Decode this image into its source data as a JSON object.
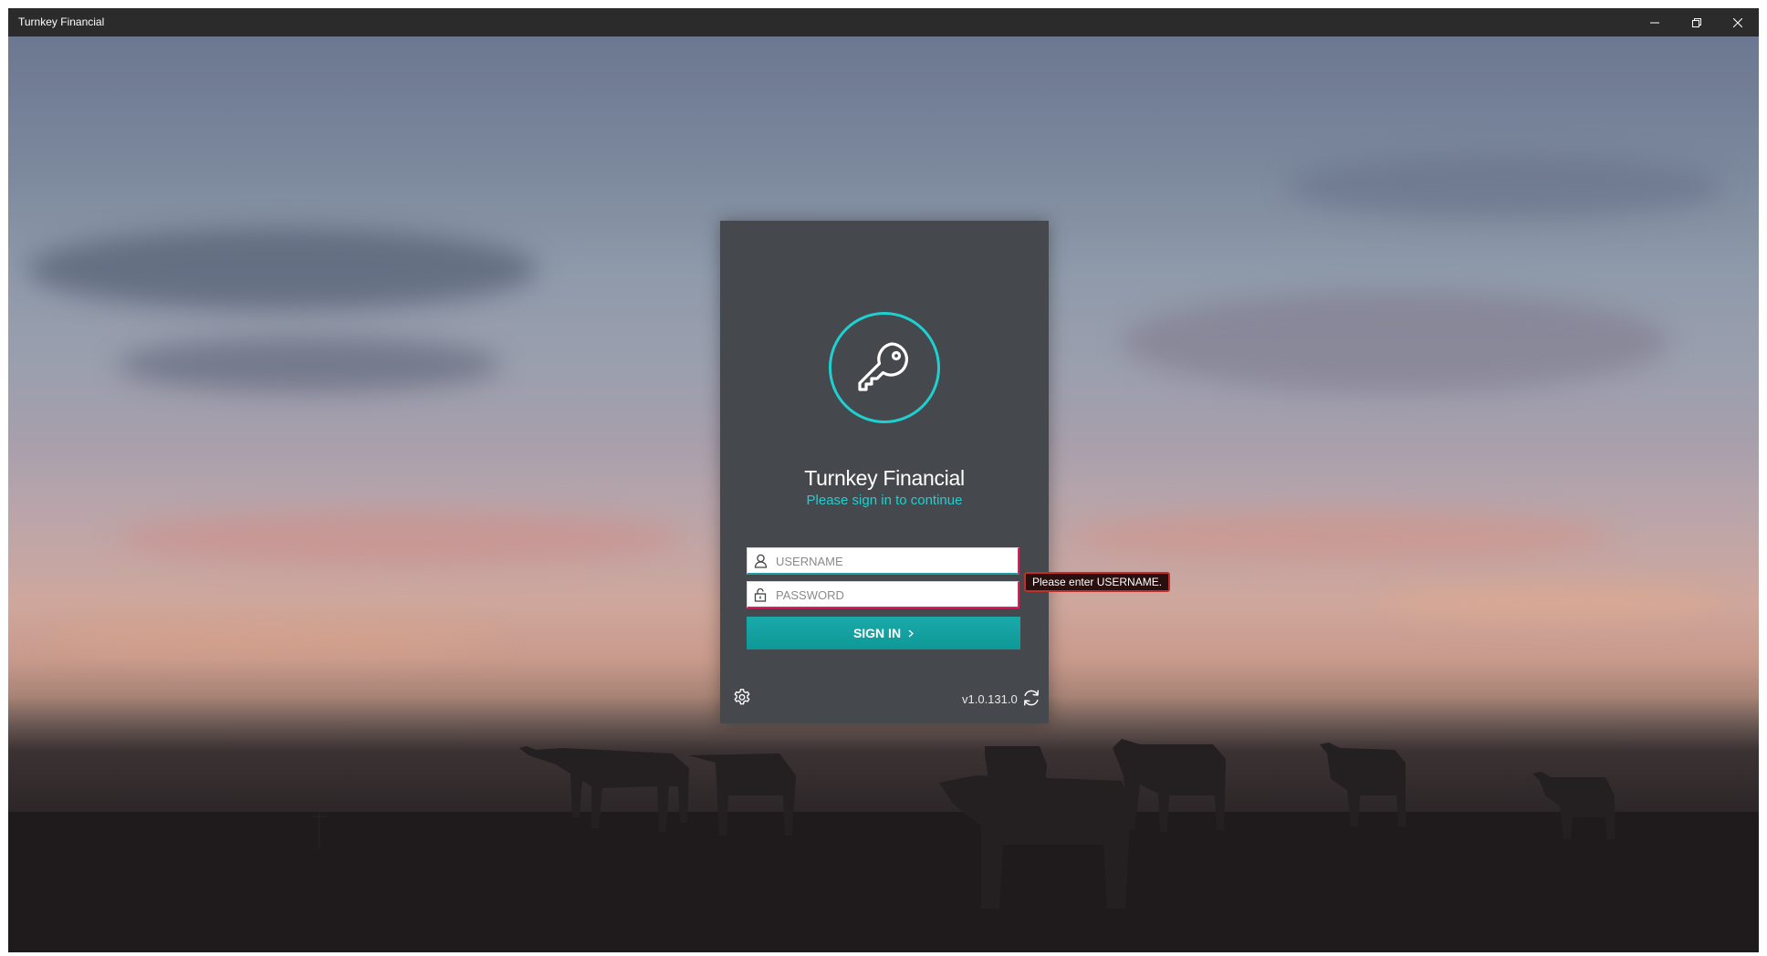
{
  "window": {
    "title": "Turnkey Financial",
    "controls": {
      "minimize": "minimize-icon",
      "restore": "restore-icon",
      "close": "close-icon"
    }
  },
  "login": {
    "logo_icon": "key-icon",
    "app_name": "Turnkey Financial",
    "subtitle": "Please sign in to continue",
    "username": {
      "placeholder": "USERNAME",
      "value": "",
      "icon": "user-icon"
    },
    "password": {
      "placeholder": "PASSWORD",
      "value": "",
      "icon": "lock-icon"
    },
    "sign_in_label": "SIGN IN",
    "validation_tooltip": "Please enter USERNAME.",
    "version": "v1.0.131.0",
    "settings_icon": "gear-icon",
    "refresh_icon": "refresh-icon"
  },
  "colors": {
    "accent": "#1fd0d0",
    "button": "#13a0a0",
    "panel": "#45484d",
    "error": "#c0302a"
  }
}
